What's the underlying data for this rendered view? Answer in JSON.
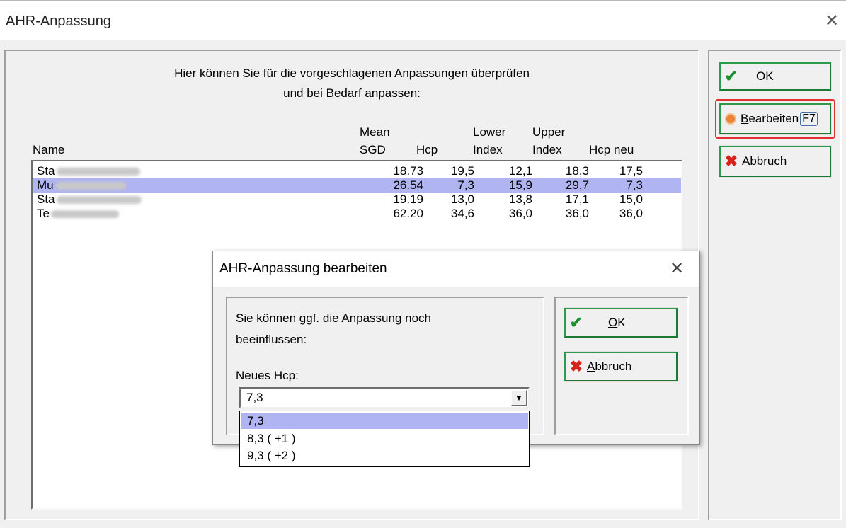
{
  "main_window": {
    "title": "AHR-Anpassung",
    "close_glyph": "✕",
    "intro_line1": "Hier können Sie für die vorgeschlagenen Anpassungen überprüfen",
    "intro_line2": "und bei Bedarf anpassen:"
  },
  "table": {
    "headers": {
      "name": "Name",
      "mean_line1": "Mean",
      "mean_line2": "SGD",
      "hcp": "Hcp",
      "lower_line1": "Lower",
      "lower_line2": "Index",
      "upper_line1": "Upper",
      "upper_line2": "Index",
      "hcp_neu": "Hcp neu"
    },
    "rows": [
      {
        "name": "Sta",
        "mean_sgd": "18.73",
        "hcp": "19,5",
        "lower": "12,1",
        "upper": "18,3",
        "hcp_neu": "17,5",
        "selected": false
      },
      {
        "name": "Mu",
        "mean_sgd": "26.54",
        "hcp": "7,3",
        "lower": "15,9",
        "upper": "29,7",
        "hcp_neu": "7,3",
        "selected": true
      },
      {
        "name": "Sta",
        "mean_sgd": "19.19",
        "hcp": "13,0",
        "lower": "13,8",
        "upper": "17,1",
        "hcp_neu": "15,0",
        "selected": false
      },
      {
        "name": "Te",
        "mean_sgd": "62.20",
        "hcp": "34,6",
        "lower": "36,0",
        "upper": "36,0",
        "hcp_neu": "36,0",
        "selected": false
      }
    ]
  },
  "buttons": {
    "ok_label": "OK",
    "bearbeiten_label": "Bearbeiten",
    "bearbeiten_key": "F7",
    "abbruch_label": "Abbruch"
  },
  "dialog": {
    "title": "AHR-Anpassung bearbeiten",
    "close_glyph": "✕",
    "message_line1": "Sie können ggf. die Anpassung noch",
    "message_line2": "beeinflussen:",
    "field_label": "Neues Hcp:",
    "combo_value": "7,3",
    "options": [
      "7,3",
      "8,3 ( +1 )",
      "9,3 ( +2 )"
    ],
    "selected_option": "7,3",
    "ok_label": "OK",
    "abbruch_label": "Abbruch"
  },
  "colors": {
    "selection": "#b0b4f0",
    "ok_icon": "#1b8f2d",
    "cancel_icon": "#d6241b",
    "edit_icon": "#e8843a",
    "highlight_border": "#e03030"
  },
  "icons": [
    "check-icon",
    "x-icon",
    "edit-dot-icon",
    "close-icon",
    "dropdown-arrow-icon"
  ]
}
